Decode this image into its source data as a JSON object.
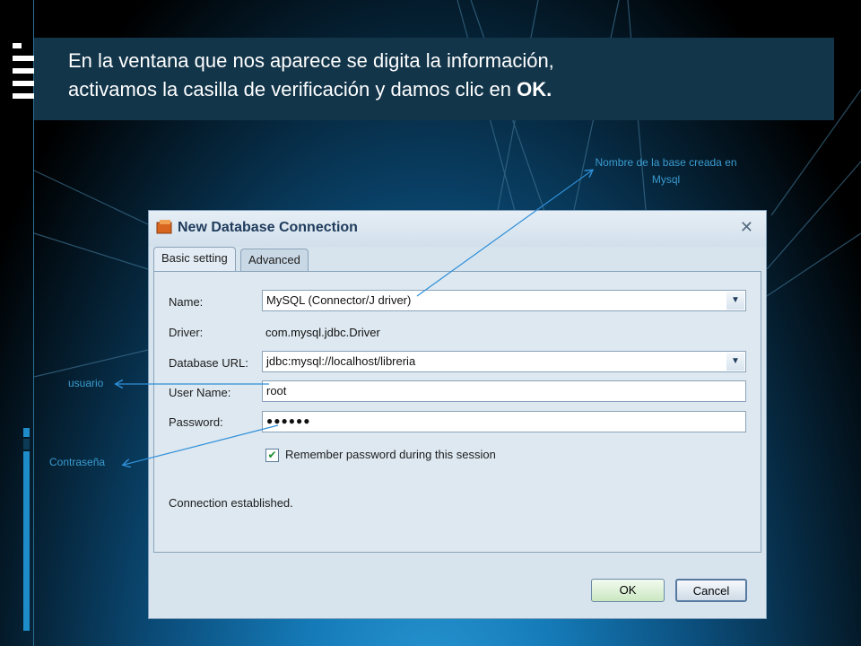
{
  "slide": {
    "title_line1": "En la ventana que nos aparece se digita la información,",
    "title_line2_prefix": "activamos la casilla de verificación y damos clic en ",
    "title_line2_bold": "OK.",
    "callout_db_line1": "Nombre de la base creada en",
    "callout_db_line2": "Mysql",
    "callout_user": "usuario",
    "callout_password": "Contraseña"
  },
  "dialog": {
    "title": "New Database Connection",
    "tabs": [
      "Basic setting",
      "Advanced"
    ],
    "fields": {
      "name_label": "Name:",
      "name_value": "MySQL (Connector/J driver)",
      "driver_label": "Driver:",
      "driver_value": "com.mysql.jdbc.Driver",
      "url_label": "Database URL:",
      "url_value": "jdbc:mysql://localhost/libreria",
      "user_label": "User Name:",
      "user_value": "root",
      "password_label": "Password:",
      "password_value": "●●●●●●"
    },
    "remember_label": "Remember password during this session",
    "remember_checked": true,
    "status": "Connection established.",
    "ok_label": "OK",
    "cancel_label": "Cancel"
  },
  "colors": {
    "title_band": "#12354a",
    "callout_text": "#3a9bd0",
    "dialog_bg": "#d7e4ee"
  }
}
